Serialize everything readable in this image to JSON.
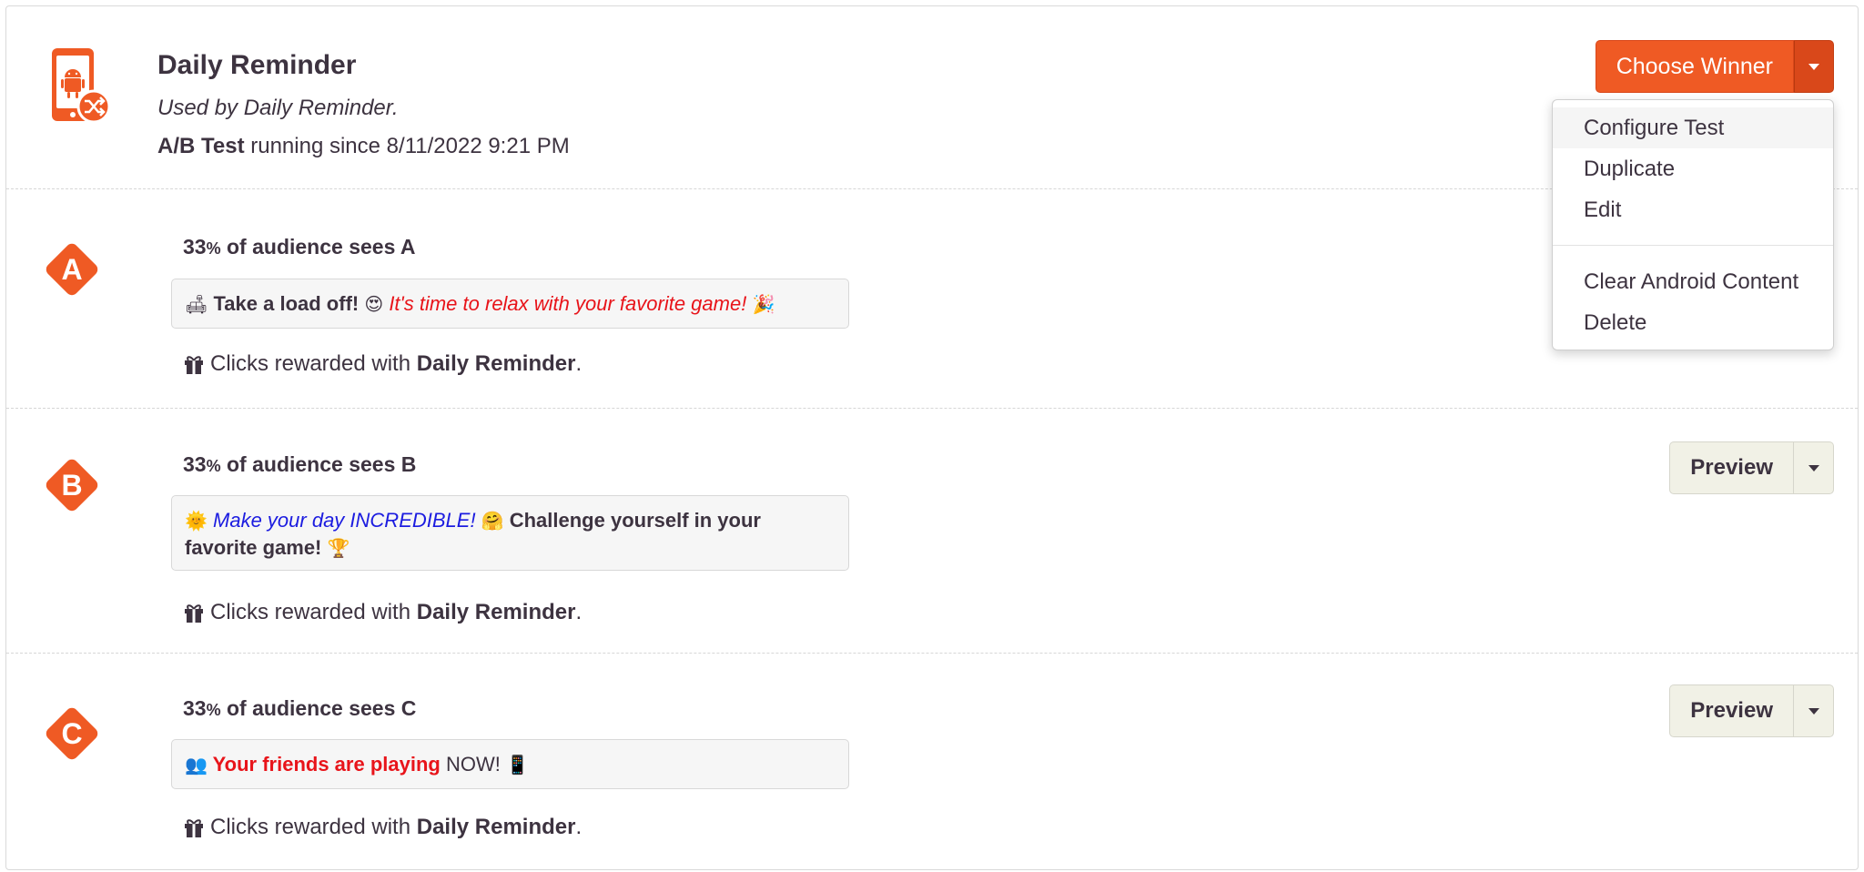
{
  "header": {
    "title": "Daily Reminder",
    "subtitle": "Used by Daily Reminder.",
    "status_label": "A/B Test",
    "status_text": " running since 8/11/2022 9:21 PM",
    "icon": "android-phone-shuffle-icon"
  },
  "actions": {
    "choose_winner_label": "Choose Winner",
    "menu": [
      {
        "label": "Configure Test"
      },
      {
        "label": "Duplicate"
      },
      {
        "label": "Edit"
      },
      {
        "label": "Clear Android Content"
      },
      {
        "label": "Delete"
      }
    ]
  },
  "variants": [
    {
      "letter": "A",
      "pct": "33",
      "pct_symbol": "%",
      "audience_text": " of audience sees A",
      "msg_emoji1": "🛋",
      "msg_bold": " Take a load off! ",
      "msg_emoji2": "😍",
      "msg_italic": " It's time to relax with your favorite game! ",
      "msg_emoji3": "🎉",
      "reward_prefix": "Clicks rewarded with ",
      "reward_bold": "Daily Reminder",
      "reward_suffix": "."
    },
    {
      "letter": "B",
      "pct": "33",
      "pct_symbol": "%",
      "audience_text": " of audience sees B",
      "msg_emoji1": "🌞",
      "msg_italic": " Make your day INCREDIBLE! ",
      "msg_emoji2": "🤗",
      "msg_bold": " Challenge yourself in your favorite game! ",
      "msg_emoji3": "🏆",
      "reward_prefix": "Clicks rewarded with ",
      "reward_bold": "Daily Reminder",
      "reward_suffix": ".",
      "preview_label": "Preview"
    },
    {
      "letter": "C",
      "pct": "33",
      "pct_symbol": "%",
      "audience_text": " of audience sees C",
      "msg_emoji1": "👥",
      "msg_bold_red": " Your friends are playing ",
      "msg_plain": "NOW! ",
      "msg_emoji2": "📱",
      "reward_prefix": "Clicks rewarded with ",
      "reward_bold": "Daily Reminder",
      "reward_suffix": ".",
      "preview_label": "Preview"
    }
  ],
  "colors": {
    "accent": "#ef5a24",
    "text": "#3d3340",
    "red": "#e8141a",
    "blue": "#1c1ce0"
  }
}
